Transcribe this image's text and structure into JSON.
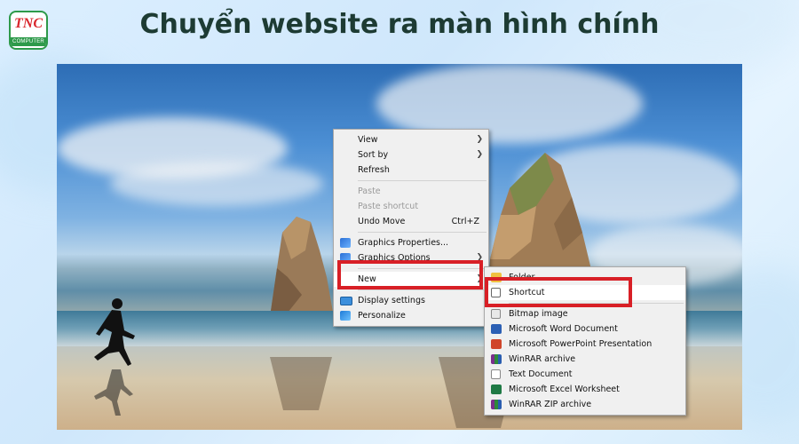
{
  "header": {
    "title": "Chuyển website ra màn hình chính",
    "logo_text": "TNC",
    "logo_sub": "COMPUTER"
  },
  "context_menu": {
    "items": [
      {
        "label": "View",
        "submenu": true
      },
      {
        "label": "Sort by",
        "submenu": true
      },
      {
        "label": "Refresh"
      },
      {
        "label": "Paste",
        "disabled": true
      },
      {
        "label": "Paste shortcut",
        "disabled": true
      },
      {
        "label": "Undo Move",
        "shortcut": "Ctrl+Z"
      },
      {
        "label": "Graphics Properties...",
        "icon": "graphics-icon"
      },
      {
        "label": "Graphics Options",
        "icon": "graphics-icon",
        "submenu": true
      },
      {
        "label": "New",
        "submenu": true
      },
      {
        "label": "Display settings",
        "icon": "display-icon"
      },
      {
        "label": "Personalize",
        "icon": "personalize-icon"
      }
    ]
  },
  "new_submenu": {
    "items": [
      {
        "label": "Folder",
        "icon": "folder-icon"
      },
      {
        "label": "Shortcut",
        "icon": "shortcut-icon"
      },
      {
        "label": "Bitmap image",
        "icon": "bitmap-icon"
      },
      {
        "label": "Microsoft Word Document",
        "icon": "word-icon"
      },
      {
        "label": "Microsoft PowerPoint Presentation",
        "icon": "powerpoint-icon"
      },
      {
        "label": "WinRAR archive",
        "icon": "winrar-icon"
      },
      {
        "label": "Text Document",
        "icon": "text-document-icon"
      },
      {
        "label": "Microsoft Excel Worksheet",
        "icon": "excel-icon"
      },
      {
        "label": "WinRAR ZIP archive",
        "icon": "winrar-zip-icon"
      }
    ]
  },
  "colors": {
    "highlight_border": "#d81f26",
    "title_text": "#1d3b33",
    "logo_red": "#d9262c",
    "logo_green": "#2e9a4a"
  }
}
